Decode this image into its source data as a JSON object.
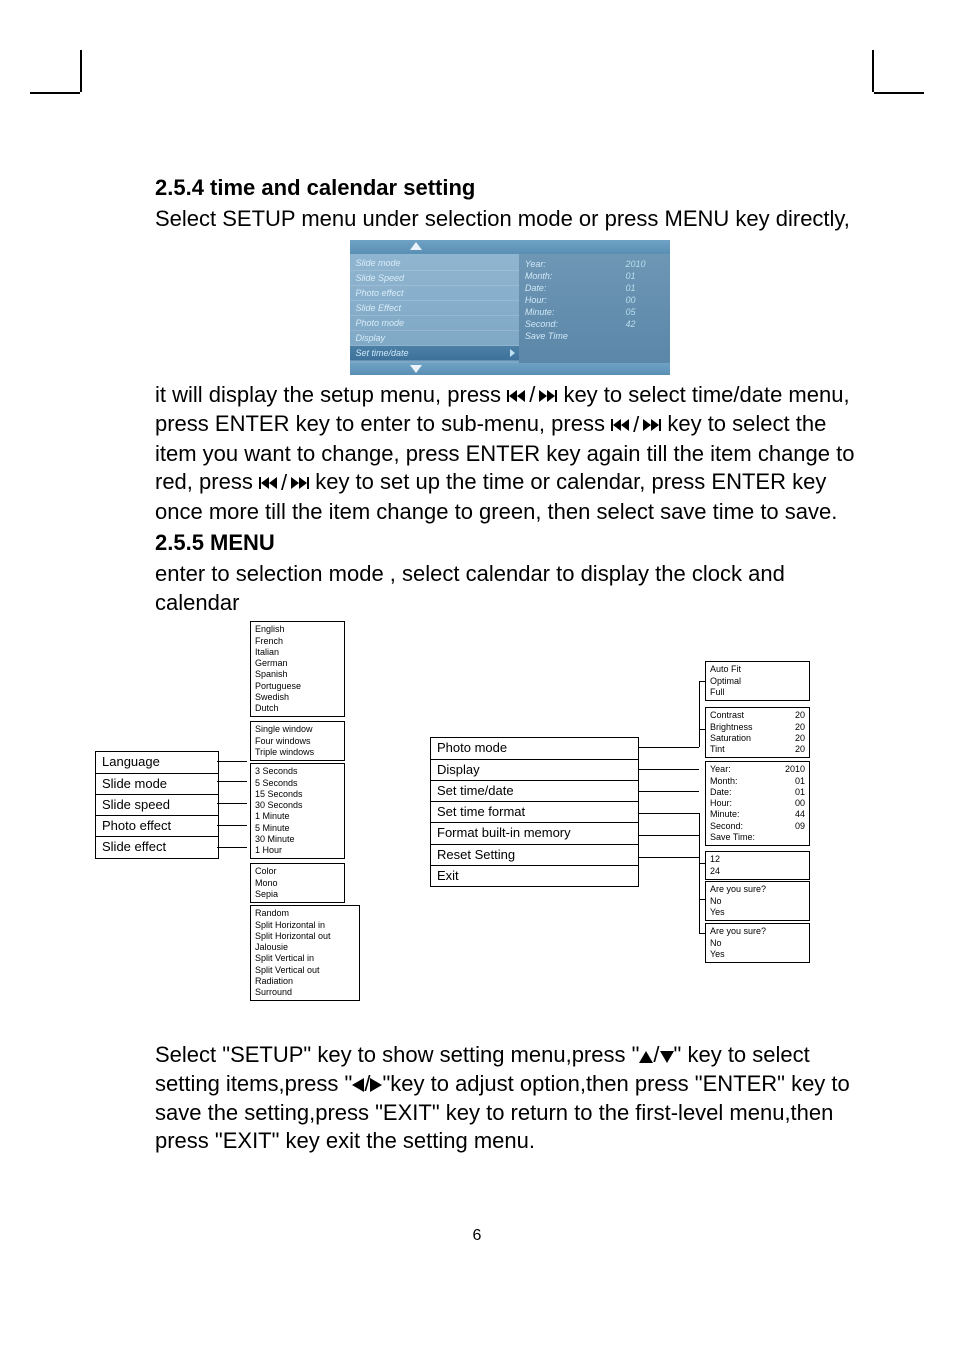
{
  "page_number": "6",
  "section254": {
    "heading": "2.5.4 time and calendar setting",
    "intro": "Select SETUP menu under selection mode or press MENU key directly,",
    "para_a": "it will display the setup menu,  press",
    "para_b": "key to select time/date menu, press ENTER key to enter to sub-menu, press",
    "para_c": "key to select the item you want to change, press ENTER key again till the item change to red, press",
    "para_d": "key to set up the time or calendar, press ENTER key once more till the item change to green, then select save time to save.",
    "setup": {
      "left": [
        "Slide mode",
        "Slide Speed",
        "Photo effect",
        "Slide Effect",
        "Photo mode",
        "Display",
        "Set time/date"
      ],
      "right": [
        {
          "k": "Year:",
          "v": "2010"
        },
        {
          "k": "Month:",
          "v": "01"
        },
        {
          "k": "Date:",
          "v": "01"
        },
        {
          "k": "Hour:",
          "v": "00"
        },
        {
          "k": "Minute:",
          "v": "05"
        },
        {
          "k": "Second:",
          "v": "42"
        },
        {
          "k": "Save Time",
          "v": ""
        }
      ]
    }
  },
  "section255": {
    "heading": "2.5.5 MENU",
    "intro": "enter to selection mode , select calendar to display the clock and calendar",
    "footer_a": "Select \"SETUP\" key to show setting menu,press \"",
    "footer_b": "\" key to select setting items,press \"",
    "footer_c": "\"key to adjust option,then press \"ENTER\" key to save the setting,press \"EXIT\" key to return to the first-level menu,then press \"EXIT\" key exit the setting menu."
  },
  "diagram": {
    "leftStack": [
      "Language",
      "Slide mode",
      "Slide speed",
      "Photo effect",
      "Slide effect"
    ],
    "languages": [
      "English",
      "French",
      "Italian",
      "German",
      "Spanish",
      "Portuguese",
      "Swedish",
      "Dutch"
    ],
    "slideModes": [
      "Single window",
      "Four windows",
      "Triple windows"
    ],
    "slideSpeeds": [
      "3 Seconds",
      "5 Seconds",
      "15 Seconds",
      "30 Seconds",
      "1 Minute",
      "5 Minute",
      "30 Minute",
      "1 Hour"
    ],
    "photoEffects": [
      "Color",
      "Mono",
      "Sepia"
    ],
    "slideEffects": [
      "Random",
      "Split Horizontal in",
      "Split Horizontal out",
      "Jalousie",
      "Split Vertical in",
      "Split Vertical out",
      "Radiation",
      "Surround"
    ],
    "centerStack": [
      "Photo mode",
      "Display",
      "Set time/date",
      "Set time format",
      "Format built-in memory",
      "Reset Setting",
      "Exit"
    ],
    "photoModes": [
      "Auto Fit",
      "Optimal",
      "Full"
    ],
    "displayOpts": [
      {
        "k": "Contrast",
        "v": "20"
      },
      {
        "k": "Brightness",
        "v": "20"
      },
      {
        "k": "Saturation",
        "v": "20"
      },
      {
        "k": "Tint",
        "v": "20"
      }
    ],
    "timeDate": [
      {
        "k": "Year:",
        "v": "2010"
      },
      {
        "k": "Month:",
        "v": "01"
      },
      {
        "k": "Date:",
        "v": "01"
      },
      {
        "k": "Hour:",
        "v": "00"
      },
      {
        "k": "Minute:",
        "v": "44"
      },
      {
        "k": "Second:",
        "v": "09"
      },
      {
        "k": "Save Time:",
        "v": ""
      }
    ],
    "timeFormat": [
      "12",
      "24"
    ],
    "confirm": [
      "Are you sure?",
      "No",
      "Yes"
    ]
  }
}
